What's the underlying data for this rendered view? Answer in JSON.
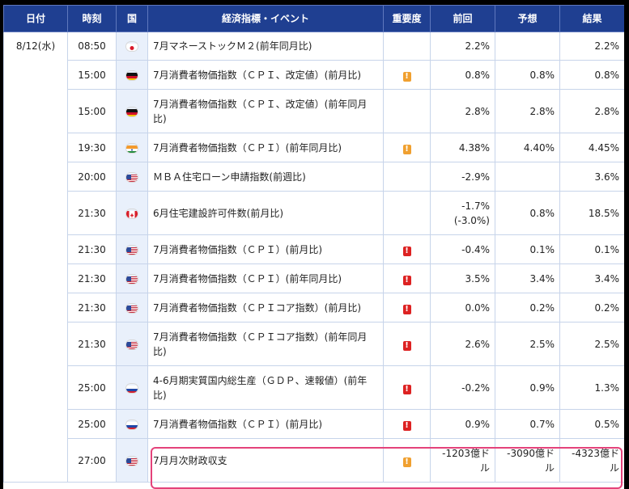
{
  "columns": {
    "date": "日付",
    "time": "時刻",
    "country": "国",
    "event": "経済指標・イベント",
    "importance": "重要度",
    "previous": "前回",
    "forecast": "予想",
    "result": "結果"
  },
  "date_value": "8/12(水)",
  "colors": {
    "header_bg": "#1f3f91",
    "importance_medium": "#f0a030",
    "importance_high": "#dd2222",
    "highlight_border": "#e4427a"
  },
  "rows": [
    {
      "time": "08:50",
      "country_icon": "japan-flag-icon",
      "event": "7月マネーストックＭ２(前年同月比)",
      "importance": "",
      "importance_icon": "",
      "previous": "2.2%",
      "forecast": "",
      "result": "2.2%"
    },
    {
      "time": "15:00",
      "country_icon": "germany-flag-icon",
      "event": "7月消費者物価指数（ＣＰＩ、改定値）(前月比)",
      "importance": "!",
      "importance_icon": "importance-medium-icon",
      "previous": "0.8%",
      "forecast": "0.8%",
      "result": "0.8%"
    },
    {
      "time": "15:00",
      "country_icon": "germany-flag-icon",
      "event": "7月消費者物価指数（ＣＰＩ、改定値）(前年同月比)",
      "importance": "",
      "importance_icon": "",
      "previous": "2.8%",
      "forecast": "2.8%",
      "result": "2.8%"
    },
    {
      "time": "19:30",
      "country_icon": "india-flag-icon",
      "event": "7月消費者物価指数（ＣＰＩ）(前年同月比)",
      "importance": "!",
      "importance_icon": "importance-medium-icon",
      "previous": "4.38%",
      "forecast": "4.40%",
      "result": "4.45%"
    },
    {
      "time": "20:00",
      "country_icon": "us-flag-icon",
      "event": "ＭＢＡ住宅ローン申請指数(前週比)",
      "importance": "",
      "importance_icon": "",
      "previous": "-2.9%",
      "forecast": "",
      "result": "3.6%"
    },
    {
      "time": "21:30",
      "country_icon": "canada-flag-icon",
      "event": "6月住宅建設許可件数(前月比)",
      "importance": "",
      "importance_icon": "",
      "previous": "-1.7%\n(-3.0%)",
      "forecast": "0.8%",
      "result": "18.5%"
    },
    {
      "time": "21:30",
      "country_icon": "us-flag-icon",
      "event": "7月消費者物価指数（ＣＰＩ）(前月比)",
      "importance": "!",
      "importance_icon": "importance-high-icon",
      "previous": "-0.4%",
      "forecast": "0.1%",
      "result": "0.1%"
    },
    {
      "time": "21:30",
      "country_icon": "us-flag-icon",
      "event": "7月消費者物価指数（ＣＰＩ）(前年同月比)",
      "importance": "!",
      "importance_icon": "importance-high-icon",
      "previous": "3.5%",
      "forecast": "3.4%",
      "result": "3.4%"
    },
    {
      "time": "21:30",
      "country_icon": "us-flag-icon",
      "event": "7月消費者物価指数（ＣＰＩコア指数）(前月比)",
      "importance": "!",
      "importance_icon": "importance-high-icon",
      "previous": "0.0%",
      "forecast": "0.2%",
      "result": "0.2%"
    },
    {
      "time": "21:30",
      "country_icon": "us-flag-icon",
      "event": "7月消費者物価指数（ＣＰＩコア指数）(前年同月比)",
      "importance": "!",
      "importance_icon": "importance-high-icon",
      "previous": "2.6%",
      "forecast": "2.5%",
      "result": "2.5%"
    },
    {
      "time": "25:00",
      "country_icon": "russia-flag-icon",
      "event": "4-6月期実質国内総生産（ＧＤＰ、速報値）(前年比)",
      "importance": "!",
      "importance_icon": "importance-high-icon",
      "previous": "-0.2%",
      "forecast": "0.9%",
      "result": "1.3%"
    },
    {
      "time": "25:00",
      "country_icon": "russia-flag-icon",
      "event": "7月消費者物価指数（ＣＰＩ）(前月比)",
      "importance": "!",
      "importance_icon": "importance-high-icon",
      "previous": "0.9%",
      "forecast": "0.7%",
      "result": "0.5%"
    },
    {
      "time": "27:00",
      "country_icon": "us-flag-icon",
      "event": "7月月次財政収支",
      "importance": "!",
      "importance_icon": "importance-medium-icon",
      "previous": "-1203億ドル",
      "forecast": "-3090億ドル",
      "result": "-4323億ドル"
    }
  ]
}
